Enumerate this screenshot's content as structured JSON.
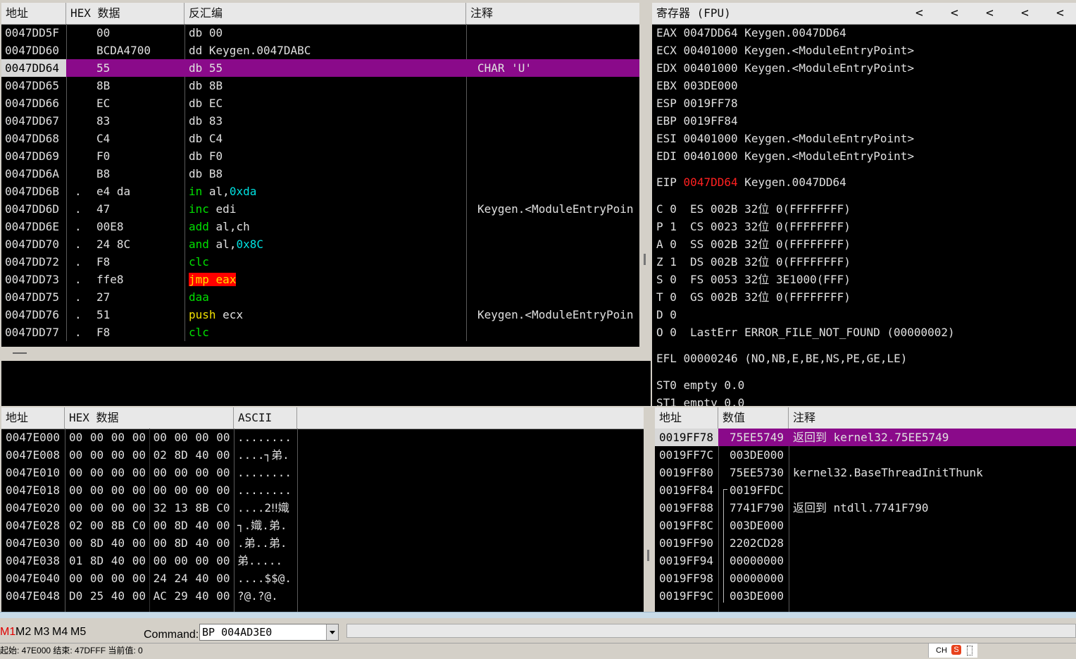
{
  "disasm": {
    "headers": [
      "地址",
      "HEX 数据",
      "反汇编",
      "注释"
    ],
    "rows": [
      {
        "addr": "0047DD5F",
        "dot": "",
        "hex": "00",
        "mn": "db",
        "ops": "00",
        "comment": ""
      },
      {
        "addr": "0047DD60",
        "dot": "",
        "hex": "BCDA4700",
        "mn": "dd",
        "ops": "Keygen.0047DABC",
        "comment": ""
      },
      {
        "addr": "0047DD64",
        "dot": "",
        "hex": "55",
        "mn": "db",
        "ops": "55",
        "comment": "CHAR 'U'"
      },
      {
        "addr": "0047DD65",
        "dot": "",
        "hex": "8B",
        "mn": "db",
        "ops": "8B",
        "comment": ""
      },
      {
        "addr": "0047DD66",
        "dot": "",
        "hex": "EC",
        "mn": "db",
        "ops": "EC",
        "comment": ""
      },
      {
        "addr": "0047DD67",
        "dot": "",
        "hex": "83",
        "mn": "db",
        "ops": "83",
        "comment": ""
      },
      {
        "addr": "0047DD68",
        "dot": "",
        "hex": "C4",
        "mn": "db",
        "ops": "C4",
        "comment": ""
      },
      {
        "addr": "0047DD69",
        "dot": "",
        "hex": "F0",
        "mn": "db",
        "ops": "F0",
        "comment": ""
      },
      {
        "addr": "0047DD6A",
        "dot": "",
        "hex": "B8",
        "mn": "db",
        "ops": "B8",
        "comment": ""
      },
      {
        "addr": "0047DD6B",
        "dot": ".",
        "hex": "e4 da",
        "mn": "in",
        "ops": "al,",
        "imm": "0xda",
        "comment": ""
      },
      {
        "addr": "0047DD6D",
        "dot": ".",
        "hex": "47",
        "mn": "inc",
        "ops": "edi",
        "comment": "Keygen.<ModuleEntryPoin"
      },
      {
        "addr": "0047DD6E",
        "dot": ".",
        "hex": "00E8",
        "mn": "add",
        "ops": "al,ch",
        "comment": ""
      },
      {
        "addr": "0047DD70",
        "dot": ".",
        "hex": "24 8C",
        "mn": "and",
        "ops": "al,",
        "imm": "0x8C",
        "comment": ""
      },
      {
        "addr": "0047DD72",
        "dot": ".",
        "hex": "F8",
        "mn": "clc",
        "ops": "",
        "comment": ""
      },
      {
        "addr": "0047DD73",
        "dot": ".",
        "hex": "ffe8",
        "mn": "jmp",
        "ops": "eax",
        "comment": ""
      },
      {
        "addr": "0047DD75",
        "dot": ".",
        "hex": "27",
        "mn": "daa",
        "ops": "",
        "comment": ""
      },
      {
        "addr": "0047DD76",
        "dot": ".",
        "hex": "51",
        "mn": "push",
        "ops": "ecx",
        "comment": "Keygen.<ModuleEntryPoin"
      },
      {
        "addr": "0047DD77",
        "dot": ".",
        "hex": "F8",
        "mn": "clc",
        "ops": "",
        "comment": ""
      }
    ]
  },
  "registers": {
    "title": "寄存器 (FPU)",
    "arrows": [
      "<",
      "<",
      "<",
      "<",
      "<"
    ],
    "gp": [
      {
        "name": "EAX",
        "val": "0047DD64",
        "sym": "Keygen.0047DD64"
      },
      {
        "name": "ECX",
        "val": "00401000",
        "sym": "Keygen.<ModuleEntryPoint>"
      },
      {
        "name": "EDX",
        "val": "00401000",
        "sym": "Keygen.<ModuleEntryPoint>"
      },
      {
        "name": "EBX",
        "val": "003DE000",
        "sym": ""
      },
      {
        "name": "ESP",
        "val": "0019FF78",
        "sym": ""
      },
      {
        "name": "EBP",
        "val": "0019FF84",
        "sym": ""
      },
      {
        "name": "ESI",
        "val": "00401000",
        "sym": "Keygen.<ModuleEntryPoint>"
      },
      {
        "name": "EDI",
        "val": "00401000",
        "sym": "Keygen.<ModuleEntryPoint>"
      }
    ],
    "eip": {
      "name": "EIP",
      "val": "0047DD64",
      "sym": "Keygen.0047DD64"
    },
    "flags": [
      {
        "f": "C 0",
        "seg": "ES 002B 32位 0(FFFFFFFF)"
      },
      {
        "f": "P 1",
        "seg": "CS 0023 32位 0(FFFFFFFF)"
      },
      {
        "f": "A 0",
        "seg": "SS 002B 32位 0(FFFFFFFF)"
      },
      {
        "f": "Z 1",
        "seg": "DS 002B 32位 0(FFFFFFFF)"
      },
      {
        "f": "S 0",
        "seg": "FS 0053 32位 3E1000(FFF)"
      },
      {
        "f": "T 0",
        "seg": "GS 002B 32位 0(FFFFFFFF)"
      },
      {
        "f": "D 0",
        "seg": ""
      },
      {
        "f": "O 0",
        "seg": "LastErr ERROR_FILE_NOT_FOUND (00000002)"
      }
    ],
    "efl": "EFL 00000246 (NO,NB,E,BE,NS,PE,GE,LE)",
    "st": [
      "ST0 empty 0.0",
      "ST1 empty 0.0"
    ]
  },
  "dump": {
    "headers": [
      "地址",
      "HEX 数据",
      "ASCII"
    ],
    "rows": [
      {
        "addr": "0047E000",
        "hex": "00 00 00 00 00 00 00 00",
        "ascii": "........"
      },
      {
        "addr": "0047E008",
        "hex": "00 00 00 00 02 8D 40 00",
        "ascii": "....┐弟."
      },
      {
        "addr": "0047E010",
        "hex": "00 00 00 00 00 00 00 00",
        "ascii": "........"
      },
      {
        "addr": "0047E018",
        "hex": "00 00 00 00 00 00 00 00",
        "ascii": "........"
      },
      {
        "addr": "0047E020",
        "hex": "00 00 00 00 32 13 8B C0",
        "ascii": "....2‼嬂"
      },
      {
        "addr": "0047E028",
        "hex": "02 00 8B C0 00 8D 40 00",
        "ascii": "┐.嬂.弟."
      },
      {
        "addr": "0047E030",
        "hex": "00 8D 40 00 00 8D 40 00",
        "ascii": ".弟..弟."
      },
      {
        "addr": "0047E038",
        "hex": "01 8D 40 00 00 00 00 00",
        "ascii": " 弟....."
      },
      {
        "addr": "0047E040",
        "hex": "00 00 00 00 24 24 40 00",
        "ascii": "....$$@."
      },
      {
        "addr": "0047E048",
        "hex": "D0 25 40 00 AC 29 40 00",
        "ascii": "?@.?@."
      }
    ]
  },
  "stack": {
    "headers": [
      "地址",
      "数值",
      "注释"
    ],
    "rows": [
      {
        "addr": "0019FF78",
        "val": "75EE5749",
        "comment": "返回到 kernel32.75EE5749"
      },
      {
        "addr": "0019FF7C",
        "val": "003DE000",
        "comment": ""
      },
      {
        "addr": "0019FF80",
        "val": "75EE5730",
        "comment": "kernel32.BaseThreadInitThunk"
      },
      {
        "addr": "0019FF84",
        "val": "0019FFDC",
        "comment": ""
      },
      {
        "addr": "0019FF88",
        "val": "7741F790",
        "comment": "返回到 ntdll.7741F790"
      },
      {
        "addr": "0019FF8C",
        "val": "003DE000",
        "comment": ""
      },
      {
        "addr": "0019FF90",
        "val": "2202CD28",
        "comment": ""
      },
      {
        "addr": "0019FF94",
        "val": "00000000",
        "comment": ""
      },
      {
        "addr": "0019FF98",
        "val": "00000000",
        "comment": ""
      },
      {
        "addr": "0019FF9C",
        "val": "003DE000",
        "comment": ""
      }
    ]
  },
  "cmdbar": {
    "m_buttons": [
      "M1",
      "M2",
      "M3",
      "M4",
      "M5"
    ],
    "command_label": "Command:",
    "command_value": "BP 004AD3E0"
  },
  "statusbar": {
    "text": "起始: 47E000 结束: 47DFFF 当前值: 0",
    "ime": "CH"
  },
  "colors": {
    "selection": "#8a0a8a",
    "jump_highlight": "#ff0000",
    "eip_value": "#ff2020",
    "immediate": "#00e0e0",
    "mnemonic": "#00e000"
  }
}
